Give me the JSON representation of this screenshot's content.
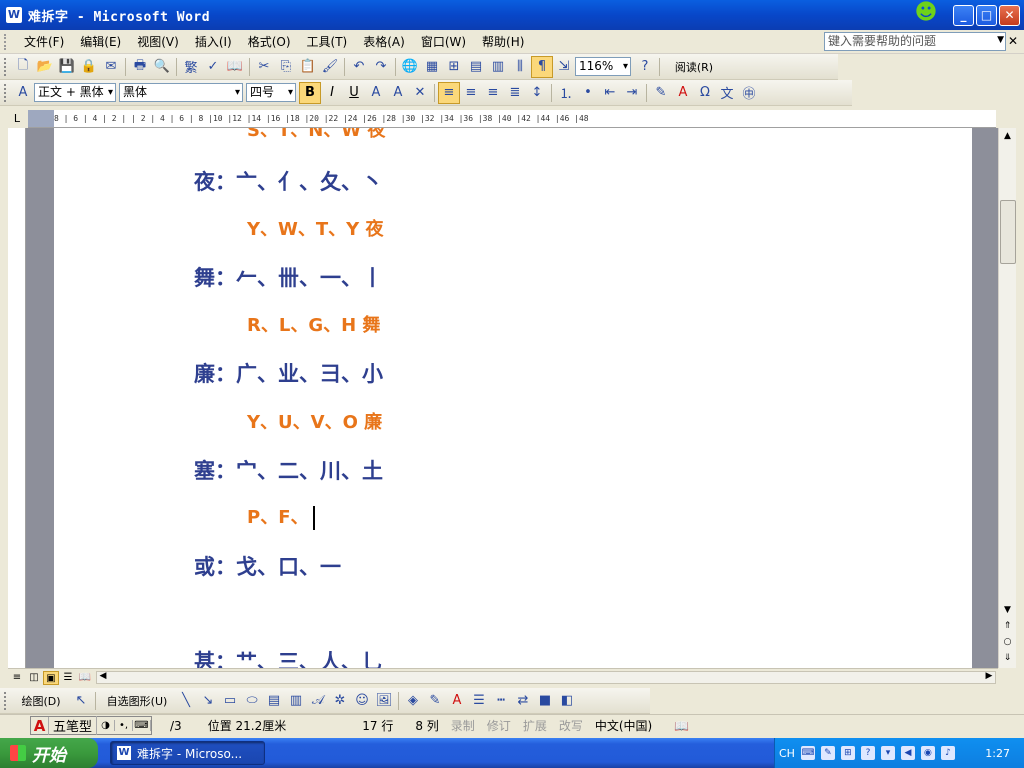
{
  "window": {
    "title": "难拆字 - Microsoft Word",
    "app_icon": "W"
  },
  "menu": {
    "items": [
      "文件(F)",
      "编辑(E)",
      "视图(V)",
      "插入(I)",
      "格式(O)",
      "工具(T)",
      "表格(A)",
      "窗口(W)",
      "帮助(H)"
    ],
    "help_placeholder": "键入需要帮助的问题"
  },
  "toolbar1": {
    "zoom": "116%",
    "read_label": "阅读(R)"
  },
  "toolbar2": {
    "style": "正文 + 黑体",
    "font": "黑体",
    "size": "四号"
  },
  "ruler": {
    "marks": "8 | 6 | 4 | 2 |   | 2 | 4 | 6 | 8 |10 |12 |14 |16 |18 |20 |22 |24 |26 |28 |30 |32 |34 |36 |38 |40 |42 |44 |46 |48"
  },
  "document": {
    "lines": [
      {
        "text": "S、T、N、W  夜",
        "kind": "orange"
      },
      {
        "text": "夜：亠、亻、夂、丶",
        "kind": "blue"
      },
      {
        "text": "Y、W、T、Y  夜",
        "kind": "orange"
      },
      {
        "text": "舞：𠂉、卌、一、丨",
        "kind": "blue"
      },
      {
        "text": "R、L、G、H  舞",
        "kind": "orange"
      },
      {
        "text": "廉：广、业、彐、小",
        "kind": "blue"
      },
      {
        "text": "Y、U、V、O  廉",
        "kind": "orange"
      },
      {
        "text": "塞：宀、二、川、土",
        "kind": "blue"
      },
      {
        "text": "P、F、",
        "kind": "orange"
      },
      {
        "text": "或：戈、口、一",
        "kind": "blue"
      },
      {
        "text": "甚：艹、三、人、乚",
        "kind": "blue"
      }
    ]
  },
  "drawbar": {
    "draw_label": "绘图(D)",
    "autoshape_label": "自选图形(U)"
  },
  "ime": {
    "a": "A",
    "name": "五笔型"
  },
  "status": {
    "page": "/3",
    "position": "位置 21.2厘米",
    "line": "17 行",
    "col": "8 列",
    "rec": "录制",
    "trk": "修订",
    "ext": "扩展",
    "ovr": "改写",
    "lang": "中文(中国)"
  },
  "taskbar": {
    "start": "开始",
    "task": "难拆字 - Microso...",
    "lang": "CH",
    "clock": "1:27"
  }
}
